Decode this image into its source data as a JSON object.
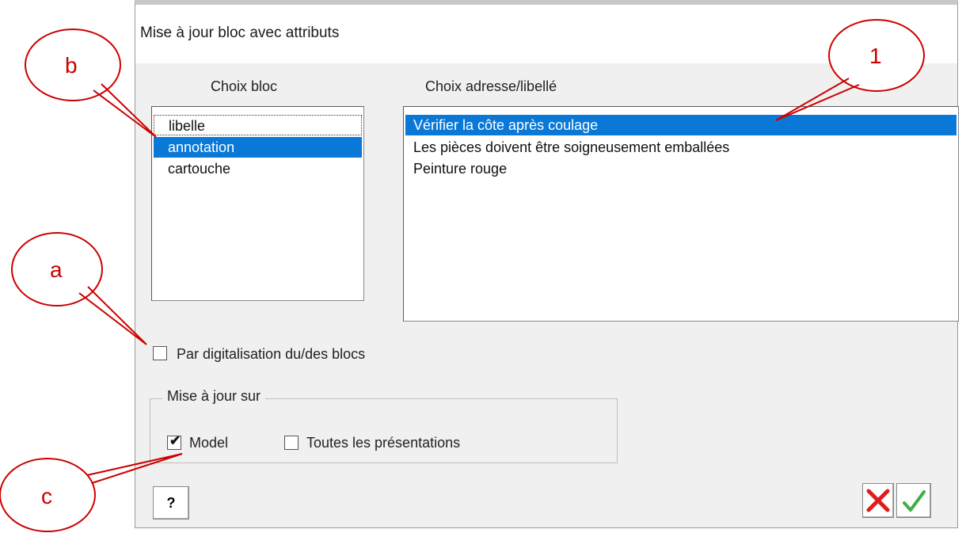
{
  "dialog": {
    "title": "Mise à jour bloc avec attributs",
    "block_list": {
      "label": "Choix bloc",
      "items": [
        "libelle",
        "annotation",
        "cartouche"
      ],
      "selected": "annotation"
    },
    "address_list": {
      "label": "Choix adresse/libellé",
      "items": [
        "Vérifier la côte après coulage",
        "Les pièces doivent être soigneusement emballées",
        "Peinture rouge"
      ],
      "selected": "Vérifier la côte après coulage"
    },
    "digitize_checkbox": {
      "label": "Par digitalisation du/des blocs",
      "checked": false
    },
    "update_group": {
      "legend": "Mise à jour sur",
      "model": {
        "label": "Model",
        "checked": true
      },
      "layouts": {
        "label": "Toutes les présentations",
        "checked": false
      }
    },
    "help_button": "?",
    "cancel_icon": "red-cross-icon",
    "ok_icon": "green-check-icon"
  },
  "callouts": {
    "b": "b",
    "one": "1",
    "a": "a",
    "c": "c"
  },
  "colors": {
    "selection": "#0a78d7",
    "callout": "#cc0000",
    "ok": "#3cb043",
    "cancel": "#e11b1b"
  }
}
